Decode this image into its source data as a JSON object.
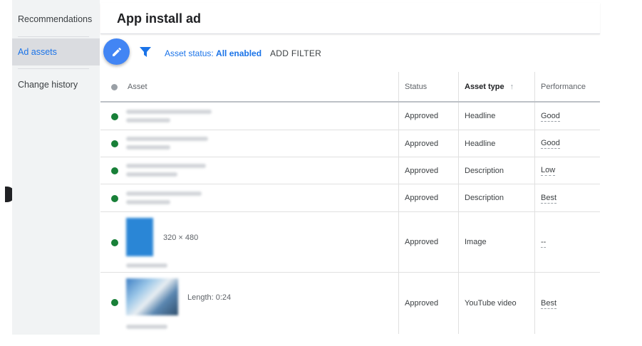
{
  "sidebar": {
    "items": [
      {
        "label": "Recommendations",
        "active": false
      },
      {
        "label": "Ad assets",
        "active": true
      },
      {
        "label": "Change history",
        "active": false
      }
    ]
  },
  "header": {
    "title": "App install ad"
  },
  "toolbar": {
    "edit_icon": "pencil-icon",
    "filter_icon": "funnel-icon",
    "status_filter_prefix": "Asset status:",
    "status_filter_value": "All enabled",
    "add_filter_label": "ADD FILTER"
  },
  "table": {
    "columns": [
      "Asset",
      "Status",
      "Asset type",
      "Performance"
    ],
    "sort_indicator": "↑",
    "rows": [
      {
        "status": "Approved",
        "asset_type": "Headline",
        "performance": "Good"
      },
      {
        "status": "Approved",
        "asset_type": "Headline",
        "performance": "Good"
      },
      {
        "status": "Approved",
        "asset_type": "Description",
        "performance": "Low"
      },
      {
        "status": "Approved",
        "asset_type": "Description",
        "performance": "Best"
      },
      {
        "status": "Approved",
        "asset_type": "Image",
        "performance": "--",
        "asset_meta": "320 × 480"
      },
      {
        "status": "Approved",
        "asset_type": "YouTube video",
        "performance": "Best",
        "asset_meta": "Length: 0:24"
      }
    ]
  },
  "colors": {
    "accent": "#1a73e8",
    "fab": "#4285f4",
    "status_enabled": "#188038",
    "sidebar_bg": "#f1f3f4"
  }
}
